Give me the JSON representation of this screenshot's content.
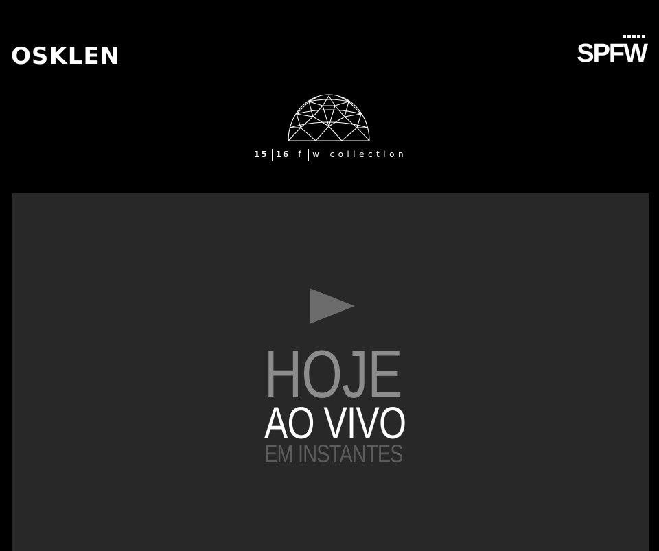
{
  "header": {
    "brand": "OSKLEN",
    "event": "SPFW",
    "collection": {
      "season_a": "15",
      "season_b": "16",
      "line_a": "f",
      "line_b": "w",
      "label": "collection"
    }
  },
  "icons": {
    "dome": "geodesic-dome-icon",
    "play": "play-icon"
  },
  "video": {
    "headline": "HOJE",
    "subheadline": "AO VIVO",
    "status": "EM INSTANTES"
  },
  "colors": {
    "page_background": "#000000",
    "player_background": "#282828",
    "play_icon": "#6c6c6c",
    "headline": "#8c8c8c",
    "subheadline": "#ffffff",
    "status": "#5c5c5c"
  }
}
